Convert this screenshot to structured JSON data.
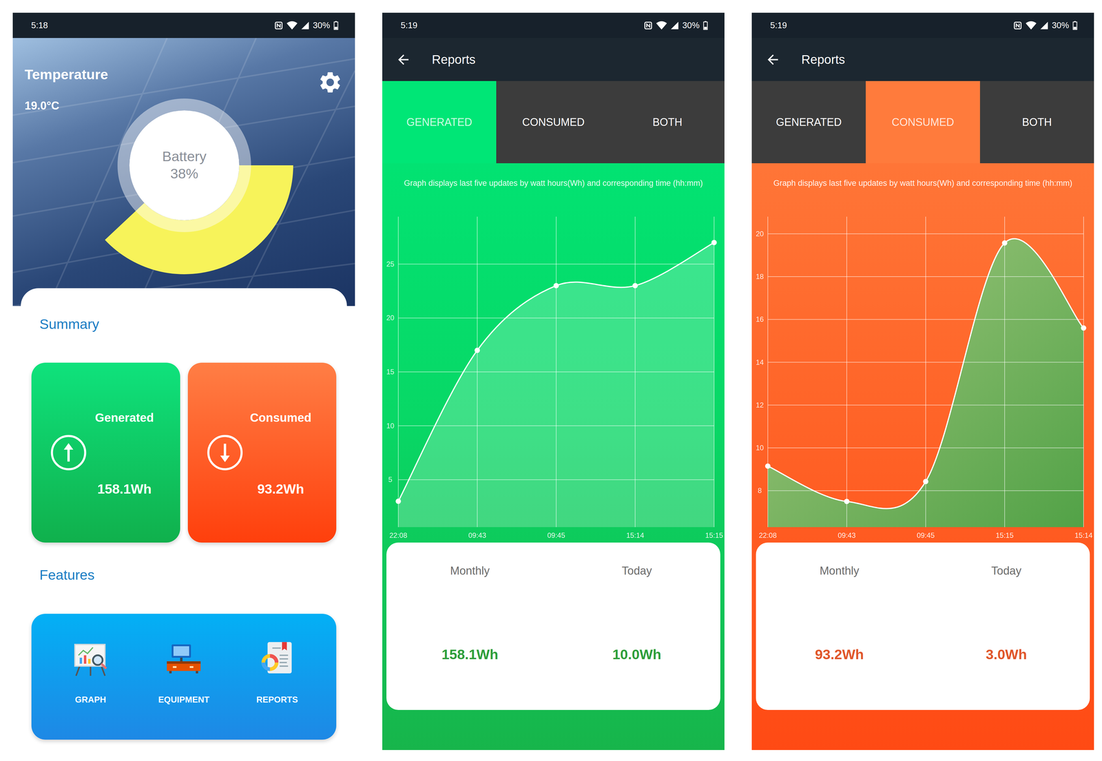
{
  "screens": [
    {
      "kind": "home",
      "status_bar": {
        "time": "5:18",
        "battery": "30%"
      },
      "header": {
        "title": "Temperature",
        "temperature": "19.0°C"
      },
      "battery": {
        "label": "Battery",
        "reading": "38%",
        "level": 0.38
      },
      "summary": {
        "title": "Summary",
        "cards": [
          {
            "label": "Generated",
            "value": "158.1Wh",
            "kind": "up"
          },
          {
            "label": "Consumed",
            "value": "93.2Wh",
            "kind": "down"
          }
        ]
      },
      "features": {
        "title": "Features",
        "items": [
          {
            "label": "GRAPH"
          },
          {
            "label": "EQUIPMENT"
          },
          {
            "label": "REPORTS"
          }
        ]
      }
    },
    {
      "kind": "report",
      "status_bar": {
        "time": "5:19",
        "battery": "30%"
      },
      "app_bar": {
        "title": "Reports"
      },
      "tabs": [
        {
          "label": "GENERATED",
          "selected": true
        },
        {
          "label": "CONSUMED",
          "selected": false
        },
        {
          "label": "BOTH",
          "selected": false
        }
      ],
      "description": "Graph displays last five updates by watt hours(Wh) and corresponding time (hh:mm)",
      "chart": {
        "y_ticks": [
          "5",
          "10",
          "15",
          "20",
          "25"
        ],
        "x_labels": [
          "22:08",
          "09:43",
          "09:45",
          "15:14",
          "15:15"
        ],
        "y_min": 0.6,
        "y_max": 29.4,
        "values": [
          3,
          17,
          23,
          23,
          27
        ]
      },
      "stats": [
        {
          "label": "Monthly",
          "value": "158.1Wh"
        },
        {
          "label": "Today",
          "value": "10.0Wh"
        }
      ]
    },
    {
      "kind": "report",
      "status_bar": {
        "time": "5:19",
        "battery": "30%"
      },
      "app_bar": {
        "title": "Reports"
      },
      "tabs": [
        {
          "label": "GENERATED",
          "selected": false
        },
        {
          "label": "CONSUMED",
          "selected": true
        },
        {
          "label": "BOTH",
          "selected": false
        }
      ],
      "description": "Graph displays last five updates by watt hours(Wh) and corresponding time (hh:mm)",
      "chart": {
        "y_ticks": [
          "8",
          "10",
          "12",
          "14",
          "16",
          "18",
          "20"
        ],
        "x_labels": [
          "22:08",
          "09:43",
          "09:45",
          "15:15",
          "15:14"
        ],
        "y_min": 6.3,
        "y_max": 20.8,
        "values": [
          9.15,
          7.5,
          8.43,
          19.57,
          15.6
        ]
      },
      "stats": [
        {
          "label": "Monthly",
          "value": "93.2Wh"
        },
        {
          "label": "Today",
          "value": "3.0Wh"
        }
      ]
    }
  ]
}
